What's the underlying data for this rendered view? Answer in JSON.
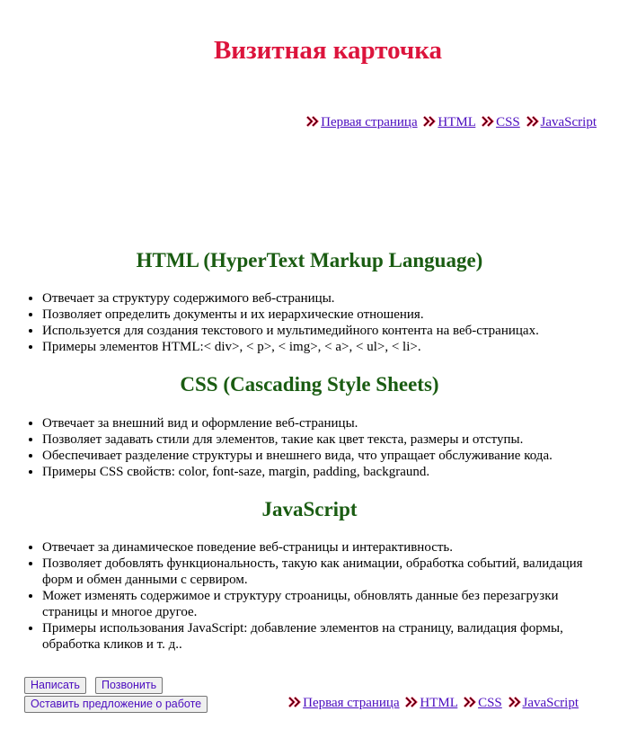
{
  "page": {
    "title": "Визитная карточка"
  },
  "nav": {
    "links": [
      "Первая страница",
      "HTML",
      "CSS",
      "JavaScript"
    ],
    "arrow_icon": "double-chevron-right-icon",
    "arrow_color": "#dc143c",
    "link_color": "#4b0cbf"
  },
  "sections": [
    {
      "heading": "HTML (HyperText Markup Language)",
      "items": [
        "Отвечает за структуру содержимого веб-страницы.",
        "Позволяет определить документы и их иерархические отношения.",
        "Используется для создания текстового и мультимедийного контента на веб-страницах.",
        "Примеры элементов HTML:< div>, < p>, < img>, < a>, < ul>, < li>."
      ]
    },
    {
      "heading": "CSS (Cascading Style Sheets)",
      "items": [
        "Отвечает за внешний вид и оформление веб-страницы.",
        "Позволяет задавать стили для элементов, такие как цвет текста, размеры и отступы.",
        "Обеспечивает разделение структуры и внешнего вида, что упращает обслуживание кода.",
        "Примеры CSS свойств: color, font-saze, margin, padding, backgraund."
      ]
    },
    {
      "heading": "JavaScript",
      "items": [
        "Отвечает за динамическое поведение веб-страницы и интерактивность.",
        "Позволяет добовлять функциональность, такую как анимации, обработка событий, валидация форм и обмен данными с сервиром.",
        "Может изменять содержимое и структуру строаницы, обновлять данные без перезагрузки страницы и многое другое.",
        "Примеры использования JavaScript: добавление элементов на страницу, валидация формы, обработка кликов и т. д.."
      ]
    }
  ],
  "buttons": {
    "write": "Написать",
    "call": "Позвонить",
    "offer": "Оставить предложение о работе"
  },
  "colors": {
    "title": "#dc143c",
    "heading": "#1a5c12"
  }
}
